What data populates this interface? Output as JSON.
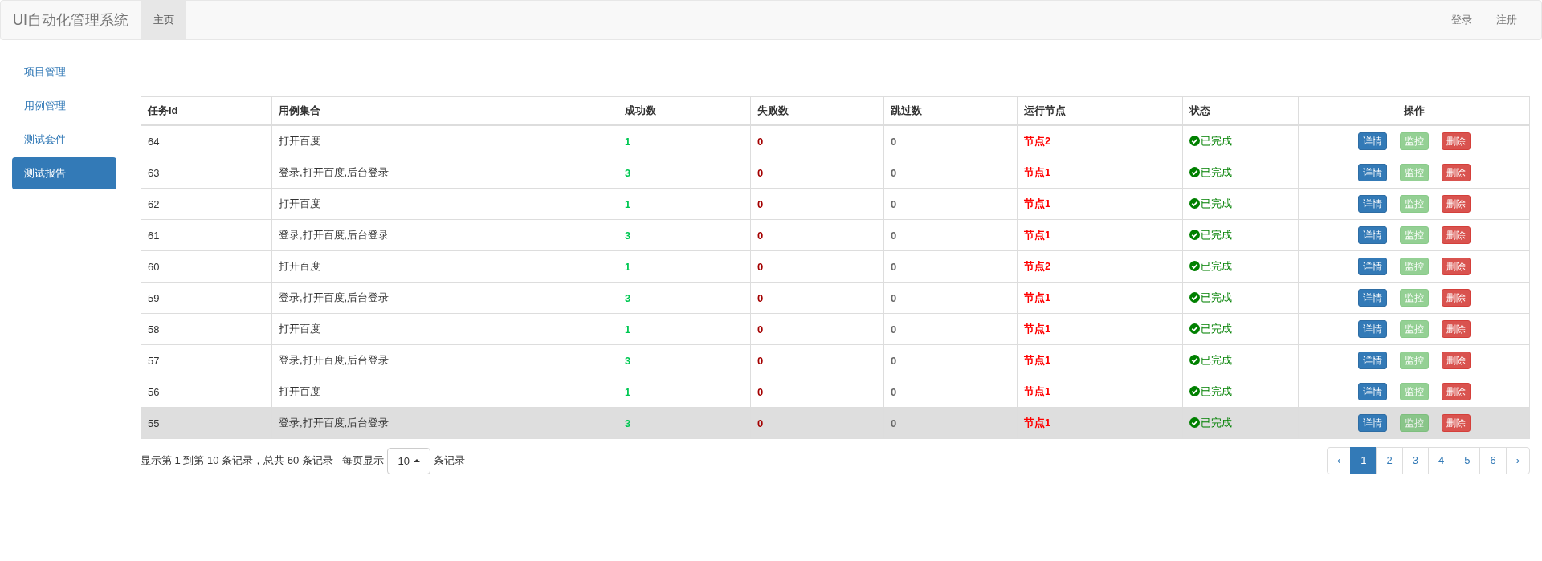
{
  "navbar": {
    "brand": "UI自动化管理系统",
    "nav": [
      {
        "label": "主页",
        "selected": true
      }
    ],
    "right_links": [
      "登录",
      "注册"
    ]
  },
  "sidebar": {
    "items": [
      {
        "label": "项目管理",
        "selected": false
      },
      {
        "label": "用例管理",
        "selected": false
      },
      {
        "label": "测试套件",
        "selected": false
      },
      {
        "label": "测试报告",
        "selected": true
      }
    ]
  },
  "table": {
    "columns": [
      {
        "label": "任务id",
        "kind": "text"
      },
      {
        "label": "用例集合",
        "kind": "text"
      },
      {
        "label": "成功数",
        "kind": "success"
      },
      {
        "label": "失败数",
        "kind": "fail"
      },
      {
        "label": "跳过数",
        "kind": "skip"
      },
      {
        "label": "运行节点",
        "kind": "node"
      },
      {
        "label": "状态",
        "kind": "status"
      },
      {
        "label": "操作",
        "kind": "actions"
      }
    ],
    "rows": [
      {
        "highlighted": false,
        "cells": [
          "64",
          "打开百度",
          "1",
          "0",
          "0",
          "节点2",
          "已完成"
        ],
        "actions": [
          {
            "label": "详情",
            "kind": "primary",
            "disabled": false
          },
          {
            "label": "监控",
            "kind": "success",
            "disabled": true
          },
          {
            "label": "删除",
            "kind": "danger",
            "disabled": false
          }
        ]
      },
      {
        "highlighted": false,
        "cells": [
          "63",
          "登录,打开百度,后台登录",
          "3",
          "0",
          "0",
          "节点1",
          "已完成"
        ],
        "actions": [
          {
            "label": "详情",
            "kind": "primary",
            "disabled": false
          },
          {
            "label": "监控",
            "kind": "success",
            "disabled": true
          },
          {
            "label": "删除",
            "kind": "danger",
            "disabled": false
          }
        ]
      },
      {
        "highlighted": false,
        "cells": [
          "62",
          "打开百度",
          "1",
          "0",
          "0",
          "节点1",
          "已完成"
        ],
        "actions": [
          {
            "label": "详情",
            "kind": "primary",
            "disabled": false
          },
          {
            "label": "监控",
            "kind": "success",
            "disabled": true
          },
          {
            "label": "删除",
            "kind": "danger",
            "disabled": false
          }
        ]
      },
      {
        "highlighted": false,
        "cells": [
          "61",
          "登录,打开百度,后台登录",
          "3",
          "0",
          "0",
          "节点1",
          "已完成"
        ],
        "actions": [
          {
            "label": "详情",
            "kind": "primary",
            "disabled": false
          },
          {
            "label": "监控",
            "kind": "success",
            "disabled": true
          },
          {
            "label": "删除",
            "kind": "danger",
            "disabled": false
          }
        ]
      },
      {
        "highlighted": false,
        "cells": [
          "60",
          "打开百度",
          "1",
          "0",
          "0",
          "节点2",
          "已完成"
        ],
        "actions": [
          {
            "label": "详情",
            "kind": "primary",
            "disabled": false
          },
          {
            "label": "监控",
            "kind": "success",
            "disabled": true
          },
          {
            "label": "删除",
            "kind": "danger",
            "disabled": false
          }
        ]
      },
      {
        "highlighted": false,
        "cells": [
          "59",
          "登录,打开百度,后台登录",
          "3",
          "0",
          "0",
          "节点1",
          "已完成"
        ],
        "actions": [
          {
            "label": "详情",
            "kind": "primary",
            "disabled": false
          },
          {
            "label": "监控",
            "kind": "success",
            "disabled": true
          },
          {
            "label": "删除",
            "kind": "danger",
            "disabled": false
          }
        ]
      },
      {
        "highlighted": false,
        "cells": [
          "58",
          "打开百度",
          "1",
          "0",
          "0",
          "节点1",
          "已完成"
        ],
        "actions": [
          {
            "label": "详情",
            "kind": "primary",
            "disabled": false
          },
          {
            "label": "监控",
            "kind": "success",
            "disabled": true
          },
          {
            "label": "删除",
            "kind": "danger",
            "disabled": false
          }
        ]
      },
      {
        "highlighted": false,
        "cells": [
          "57",
          "登录,打开百度,后台登录",
          "3",
          "0",
          "0",
          "节点1",
          "已完成"
        ],
        "actions": [
          {
            "label": "详情",
            "kind": "primary",
            "disabled": false
          },
          {
            "label": "监控",
            "kind": "success",
            "disabled": true
          },
          {
            "label": "删除",
            "kind": "danger",
            "disabled": false
          }
        ]
      },
      {
        "highlighted": false,
        "cells": [
          "56",
          "打开百度",
          "1",
          "0",
          "0",
          "节点1",
          "已完成"
        ],
        "actions": [
          {
            "label": "详情",
            "kind": "primary",
            "disabled": false
          },
          {
            "label": "监控",
            "kind": "success",
            "disabled": true
          },
          {
            "label": "删除",
            "kind": "danger",
            "disabled": false
          }
        ]
      },
      {
        "highlighted": true,
        "cells": [
          "55",
          "登录,打开百度,后台登录",
          "3",
          "0",
          "0",
          "节点1",
          "已完成"
        ],
        "actions": [
          {
            "label": "详情",
            "kind": "primary",
            "disabled": false
          },
          {
            "label": "监控",
            "kind": "success",
            "disabled": true
          },
          {
            "label": "删除",
            "kind": "danger",
            "disabled": false
          }
        ]
      }
    ]
  },
  "footer": {
    "summary": "显示第 1 到第 10 条记录，总共 60 条记录",
    "per_page_label": "每页显示",
    "per_page": "10",
    "per_page_suffix": "条记录"
  },
  "pagination": [
    {
      "label": "‹",
      "selected": false
    },
    {
      "label": "1",
      "selected": true
    },
    {
      "label": "2",
      "selected": false
    },
    {
      "label": "3",
      "selected": false
    },
    {
      "label": "4",
      "selected": false
    },
    {
      "label": "5",
      "selected": false
    },
    {
      "label": "6",
      "selected": false
    },
    {
      "label": "›",
      "selected": false
    }
  ]
}
